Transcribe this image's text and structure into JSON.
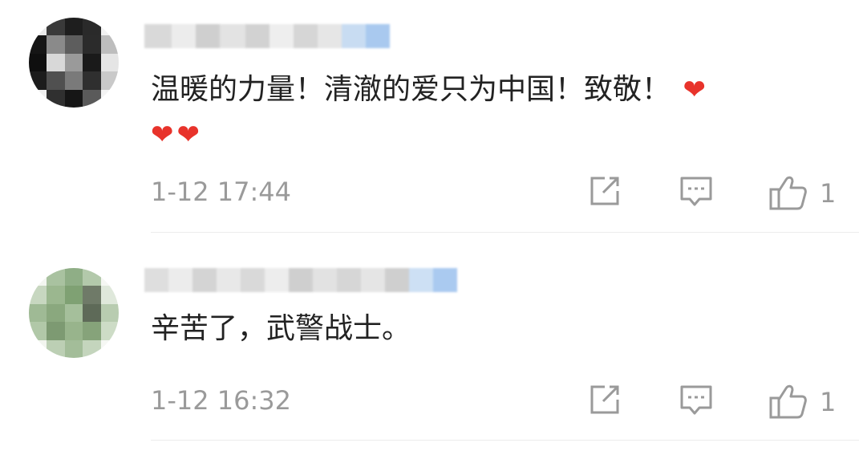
{
  "comments": [
    {
      "text": "温暖的力量！清澈的爱只为中国！致敬！",
      "hearts": [
        "❤",
        "❤",
        "❤"
      ],
      "time": "1-12 17:44",
      "likes": "1"
    },
    {
      "text": "辛苦了，武警战士。",
      "time": "1-12 16:32",
      "likes": "1"
    }
  ],
  "colors": {
    "text": "#222222",
    "meta": "#9a9a9a",
    "heart": "#e8332b",
    "divider": "#ececec"
  },
  "icons": [
    "share-icon",
    "reply-icon",
    "like-icon"
  ]
}
